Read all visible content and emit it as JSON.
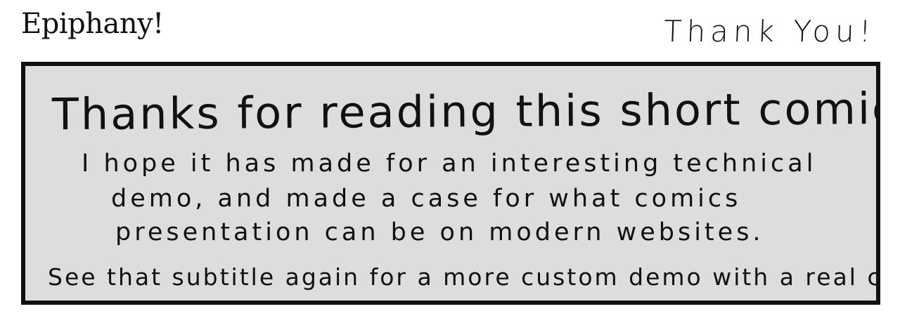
{
  "header": {
    "site_title": "Epiphany!",
    "page_heading": "Thank You!"
  },
  "panel": {
    "headline": "Thanks for reading this short comic!",
    "body_lines": [
      "I hope it has made for an interesting technical",
      "demo, and made a case for what comics",
      "presentation can be on modern websites."
    ],
    "footer": "See that subtitle again for a more custom demo with a real comic!"
  },
  "colors": {
    "panel_background": "#dddddd",
    "panel_border": "#111111",
    "page_background": "#ffffff",
    "text": "#111111"
  }
}
